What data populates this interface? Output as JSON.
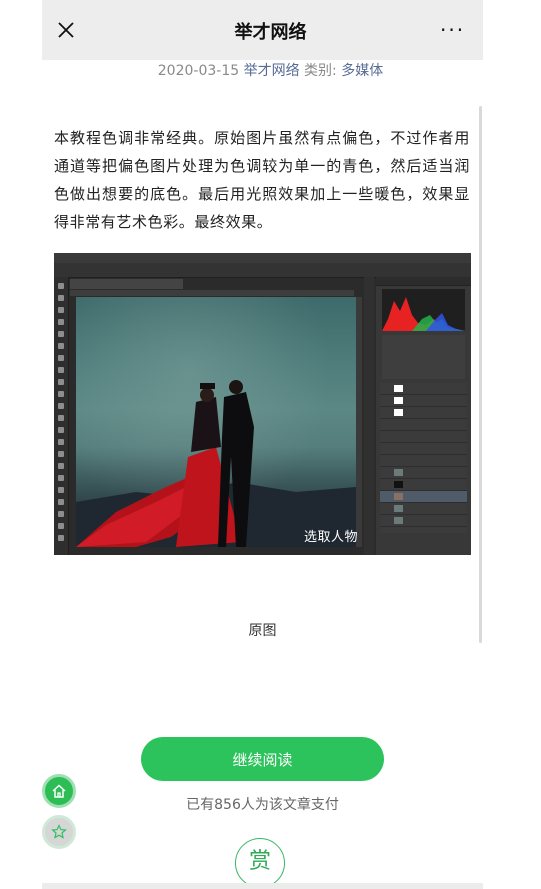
{
  "header": {
    "title": "举才网络",
    "close_icon": "close-icon",
    "more_label": "···"
  },
  "meta": {
    "date": "2020-03-15",
    "author": "举才网络",
    "category_label": "类别:",
    "category": "多媒体"
  },
  "article": {
    "paragraph": "本教程色调非常经典。原始图片虽然有点偏色，不过作者用通道等把偏色图片处理为色调较为单一的青色，然后适当润色做出想要的底色。最后用光照效果加上一些暖色，效果显得非常有艺术色彩。最终效果。",
    "screenshot_caption": "选取人物",
    "image_caption": "原图"
  },
  "actions": {
    "read_more": "继续阅读",
    "paid_count": "已有856人为该文章支付",
    "reward": "赏"
  },
  "floating": {
    "home_icon": "home-icon",
    "star_icon": "star-icon"
  },
  "colors": {
    "accent_green": "#2cc35c",
    "link_blue": "#576b95"
  }
}
